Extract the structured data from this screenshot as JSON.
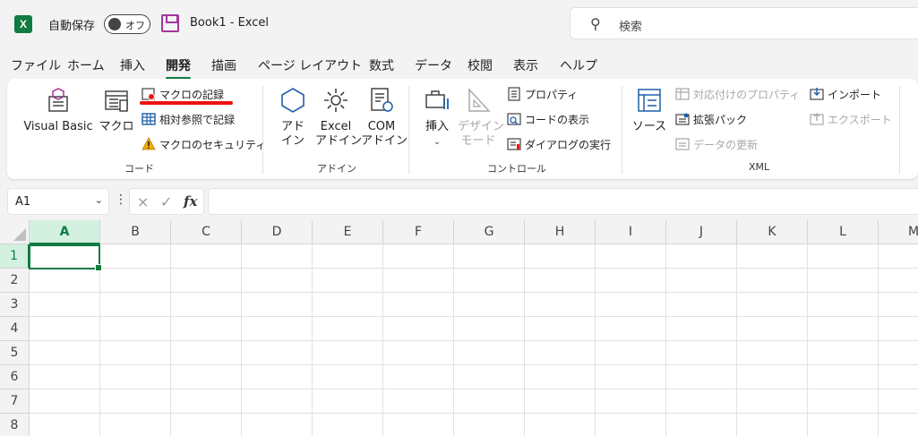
{
  "titlebar": {
    "app_logo": "excel-logo-icon",
    "autosave_label": "自動保存",
    "autosave_toggle": "オフ",
    "doc_title": "Book1  -  Excel",
    "search_placeholder": "検索"
  },
  "menu": {
    "items": [
      "ファイル",
      "ホーム",
      "挿入",
      "開発",
      "描画",
      "ページ レイアウト",
      "数式",
      "データ",
      "校閲",
      "表示",
      "ヘルプ"
    ],
    "active": "開発"
  },
  "ribbon": {
    "code": {
      "label": "コード",
      "visual_basic": "Visual Basic",
      "macro": "マクロ",
      "record_macro": "マクロの記録",
      "relative_ref": "相対参照で記録",
      "macro_security": "マクロのセキュリティ"
    },
    "addins": {
      "label": "アドイン",
      "addin_line1": "アド",
      "addin_line2": "イン",
      "excel_addin_line1": "Excel",
      "excel_addin_line2": "アドイン",
      "com_addin_line1": "COM",
      "com_addin_line2": "アドイン"
    },
    "controls": {
      "label": "コントロール",
      "insert": "挿入",
      "design_line1": "デザイン",
      "design_line2": "モード",
      "properties": "プロパティ",
      "view_code": "コードの表示",
      "run_dialog": "ダイアログの実行"
    },
    "xml": {
      "label": "XML",
      "source": "ソース",
      "map_properties": "対応付けのプロパティ",
      "expansion_packs": "拡張パック",
      "refresh_data": "データの更新",
      "import": "インポート",
      "export": "エクスポート"
    }
  },
  "formula_bar": {
    "name_box": "A1",
    "cancel_icon": "×",
    "enter_icon": "✓",
    "fx": "fx",
    "formula": ""
  },
  "grid": {
    "columns": [
      "A",
      "B",
      "C",
      "D",
      "E",
      "F",
      "G",
      "H",
      "I",
      "J",
      "K",
      "L",
      "M"
    ],
    "rows": [
      "1",
      "2",
      "3",
      "4",
      "5",
      "6",
      "7",
      "8"
    ],
    "active_cell": "A1"
  },
  "colors": {
    "accent": "#107c41",
    "underline": "#ee1111",
    "save_icon": "#a3359d"
  }
}
